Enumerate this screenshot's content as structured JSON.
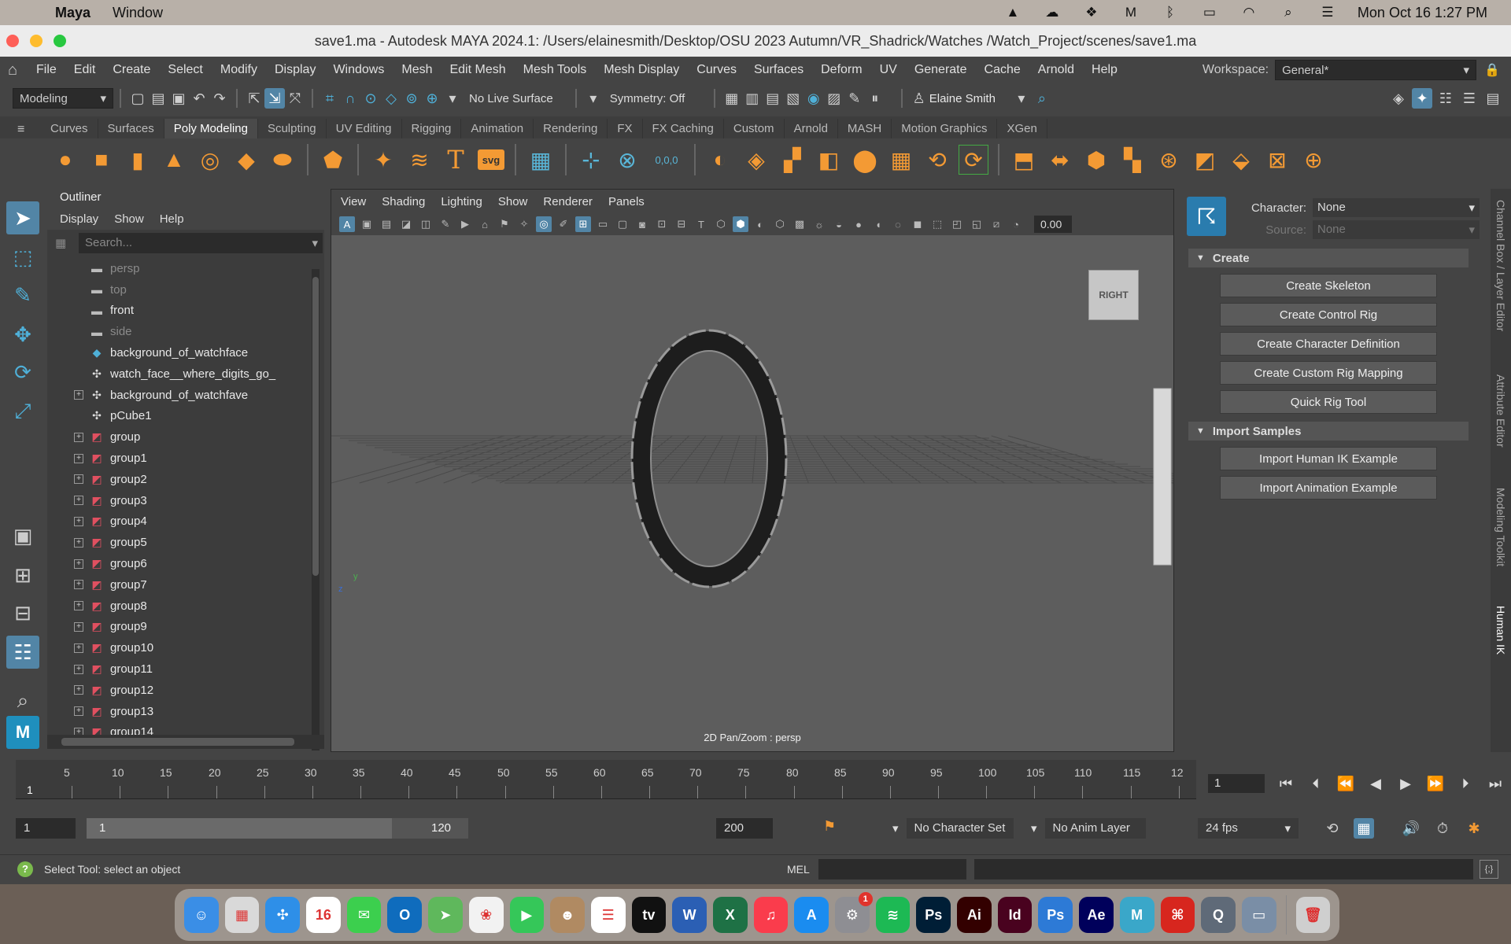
{
  "macbar": {
    "app_name": "Maya",
    "menus": [
      "Window"
    ],
    "clock": "Mon Oct 16  1:27 PM"
  },
  "window": {
    "title": "save1.ma - Autodesk MAYA 2024.1: /Users/elainesmith/Desktop/OSU 2023 Autumn/VR_Shadrick/Watches /Watch_Project/scenes/save1.ma"
  },
  "main_menu": {
    "items": [
      "File",
      "Edit",
      "Create",
      "Select",
      "Modify",
      "Display",
      "Windows",
      "Mesh",
      "Edit Mesh",
      "Mesh Tools",
      "Mesh Display",
      "Curves",
      "Surfaces",
      "Deform",
      "UV",
      "Generate",
      "Cache",
      "Arnold",
      "Help"
    ],
    "workspace_label": "Workspace:",
    "workspace_value": "General*"
  },
  "status_line": {
    "menu_set": "Modeling",
    "live_surface": "No Live Surface",
    "symmetry": "Symmetry: Off",
    "user": "Elaine Smith"
  },
  "shelf": {
    "tabs": [
      "Curves",
      "Surfaces",
      "Poly Modeling",
      "Sculpting",
      "UV Editing",
      "Rigging",
      "Animation",
      "Rendering",
      "FX",
      "FX Caching",
      "Custom",
      "Arnold",
      "MASH",
      "Motion Graphics",
      "XGen"
    ],
    "active_tab": "Poly Modeling",
    "svg_label": "svg",
    "text_icon": "T",
    "coords_label": "0,0,0"
  },
  "outliner": {
    "title": "Outliner",
    "menus": [
      "Display",
      "Show",
      "Help"
    ],
    "search_placeholder": "Search...",
    "rows": [
      {
        "label": "persp",
        "icon": "camera-icon",
        "dim": true,
        "expand": false
      },
      {
        "label": "top",
        "icon": "camera-icon",
        "dim": true,
        "expand": false
      },
      {
        "label": "front",
        "icon": "camera-icon",
        "dim": false,
        "expand": false
      },
      {
        "label": "side",
        "icon": "camera-icon",
        "dim": true,
        "expand": false
      },
      {
        "label": "background_of_watchface",
        "icon": "mesh-icon",
        "dim": false,
        "expand": false
      },
      {
        "label": "watch_face__where_digits_go_",
        "icon": "transform-icon",
        "dim": false,
        "expand": false
      },
      {
        "label": "background_of_watchfave",
        "icon": "transform-icon",
        "dim": false,
        "expand": true
      },
      {
        "label": "pCube1",
        "icon": "transform-icon",
        "dim": false,
        "expand": false
      },
      {
        "label": "group",
        "icon": "group-icon",
        "dim": false,
        "expand": true
      },
      {
        "label": "group1",
        "icon": "group-icon",
        "dim": false,
        "expand": true
      },
      {
        "label": "group2",
        "icon": "group-icon",
        "dim": false,
        "expand": true
      },
      {
        "label": "group3",
        "icon": "group-icon",
        "dim": false,
        "expand": true
      },
      {
        "label": "group4",
        "icon": "group-icon",
        "dim": false,
        "expand": true
      },
      {
        "label": "group5",
        "icon": "group-icon",
        "dim": false,
        "expand": true
      },
      {
        "label": "group6",
        "icon": "group-icon",
        "dim": false,
        "expand": true
      },
      {
        "label": "group7",
        "icon": "group-icon",
        "dim": false,
        "expand": true
      },
      {
        "label": "group8",
        "icon": "group-icon",
        "dim": false,
        "expand": true
      },
      {
        "label": "group9",
        "icon": "group-icon",
        "dim": false,
        "expand": true
      },
      {
        "label": "group10",
        "icon": "group-icon",
        "dim": false,
        "expand": true
      },
      {
        "label": "group11",
        "icon": "group-icon",
        "dim": false,
        "expand": true
      },
      {
        "label": "group12",
        "icon": "group-icon",
        "dim": false,
        "expand": true
      },
      {
        "label": "group13",
        "icon": "group-icon",
        "dim": false,
        "expand": true
      },
      {
        "label": "group14",
        "icon": "group-icon",
        "dim": false,
        "expand": true
      }
    ]
  },
  "viewport": {
    "menus": [
      "View",
      "Shading",
      "Lighting",
      "Show",
      "Renderer",
      "Panels"
    ],
    "field_value": "0.00",
    "viewcube_label": "RIGHT",
    "status_label": "2D Pan/Zoom : persp",
    "axis_y": "y",
    "axis_z": "z"
  },
  "human_ik": {
    "character_label": "Character:",
    "character_value": "None",
    "source_label": "Source:",
    "source_value": "None",
    "create_section": "Create",
    "create_buttons": [
      "Create Skeleton",
      "Create Control Rig",
      "Create Character Definition",
      "Create Custom Rig Mapping",
      "Quick Rig Tool"
    ],
    "import_section": "Import Samples",
    "import_buttons": [
      "Import Human IK Example",
      "Import Animation Example"
    ]
  },
  "side_tabs": [
    "Channel Box / Layer Editor",
    "Attribute Editor",
    "Modeling Toolkit",
    "Human IK"
  ],
  "time_slider": {
    "ticks": [
      "5",
      "10",
      "15",
      "20",
      "25",
      "30",
      "35",
      "40",
      "45",
      "50",
      "55",
      "60",
      "65",
      "70",
      "75",
      "80",
      "85",
      "90",
      "95",
      "100",
      "105",
      "110",
      "115",
      "12"
    ],
    "current_frame_marker": "1",
    "current_frame_field": "1"
  },
  "range_slider": {
    "start_field": "1",
    "range_start": "1",
    "range_end": "120",
    "end_field": "200",
    "range_fill_fraction": [
      0.0,
      0.8
    ],
    "character_set": "No Character Set",
    "anim_layer": "No Anim Layer",
    "fps": "24 fps"
  },
  "help_line": {
    "text": "Select Tool: select an object",
    "mel_label": "MEL"
  },
  "dock": {
    "apps": [
      {
        "name": "Finder",
        "icon": "finder-icon",
        "color": "#3a8ee6",
        "glyph": "☺"
      },
      {
        "name": "Launchpad",
        "icon": "launchpad-icon",
        "color": "#d9d9d9",
        "glyph": "▦"
      },
      {
        "name": "Safari",
        "icon": "safari-icon",
        "color": "#2e8fe8",
        "glyph": "✣"
      },
      {
        "name": "Calendar",
        "icon": "calendar-icon",
        "color": "#ffffff",
        "glyph": "16"
      },
      {
        "name": "Messages",
        "icon": "messages-icon",
        "color": "#3ccf4e",
        "glyph": "✉"
      },
      {
        "name": "Outlook",
        "icon": "outlook-icon",
        "color": "#0f6cbd",
        "glyph": "O"
      },
      {
        "name": "Maps",
        "icon": "maps-icon",
        "color": "#5fb85c",
        "glyph": "➤"
      },
      {
        "name": "Photos",
        "icon": "photos-icon",
        "color": "#f2f2f2",
        "glyph": "❀"
      },
      {
        "name": "FaceTime",
        "icon": "facetime-icon",
        "color": "#35c759",
        "glyph": "▶"
      },
      {
        "name": "Contacts",
        "icon": "contacts-icon",
        "color": "#b08a62",
        "glyph": "☻"
      },
      {
        "name": "Reminders",
        "icon": "reminders-icon",
        "color": "#ffffff",
        "glyph": "☰"
      },
      {
        "name": "Apple TV",
        "icon": "tv-icon",
        "color": "#111111",
        "glyph": "tv"
      },
      {
        "name": "Word",
        "icon": "word-icon",
        "color": "#2b5fb4",
        "glyph": "W"
      },
      {
        "name": "Excel",
        "icon": "excel-icon",
        "color": "#1e7145",
        "glyph": "X"
      },
      {
        "name": "Music",
        "icon": "music-icon",
        "color": "#fa3c4c",
        "glyph": "♫"
      },
      {
        "name": "App Store",
        "icon": "appstore-icon",
        "color": "#1a8cf0",
        "glyph": "A"
      },
      {
        "name": "System Settings",
        "icon": "settings-icon",
        "color": "#8e8e93",
        "glyph": "⚙",
        "badge": "1"
      },
      {
        "name": "Spotify",
        "icon": "spotify-icon",
        "color": "#1db954",
        "glyph": "≋"
      },
      {
        "name": "Photoshop",
        "icon": "photoshop-icon",
        "color": "#001e36",
        "glyph": "Ps"
      },
      {
        "name": "Illustrator",
        "icon": "illustrator-icon",
        "color": "#330000",
        "glyph": "Ai"
      },
      {
        "name": "InDesign",
        "icon": "indesign-icon",
        "color": "#49021f",
        "glyph": "Id"
      },
      {
        "name": "Photoshop 2",
        "icon": "photoshop-alt-icon",
        "color": "#2d7ad6",
        "glyph": "Ps"
      },
      {
        "name": "After Effects",
        "icon": "aftereffects-icon",
        "color": "#00005b",
        "glyph": "Ae"
      },
      {
        "name": "Maya",
        "icon": "maya-icon",
        "color": "#3aa7c9",
        "glyph": "M"
      },
      {
        "name": "Acrobat",
        "icon": "acrobat-icon",
        "color": "#d7261e",
        "glyph": "⌘"
      },
      {
        "name": "QuickTime",
        "icon": "quicktime-icon",
        "color": "#5f6a78",
        "glyph": "Q"
      },
      {
        "name": "Preview",
        "icon": "preview-icon",
        "color": "#7a8ea6",
        "glyph": "▭"
      },
      {
        "name": "Trash",
        "icon": "trash-icon",
        "color": "#cfcfcf",
        "glyph": "🗑"
      }
    ]
  },
  "colors": {
    "accent": "#5285a6",
    "shelf_icon": "#f39a34",
    "maya_blue": "#4fb0d8"
  }
}
